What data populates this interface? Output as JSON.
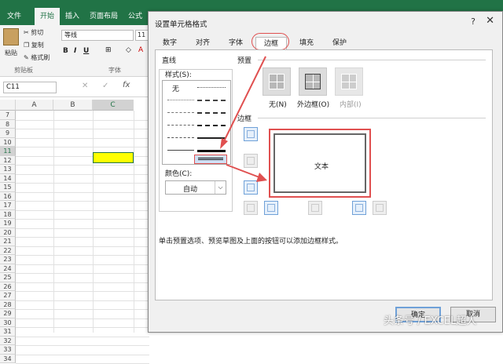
{
  "excel": {
    "tabs": [
      "文件",
      "开始",
      "插入",
      "页面布局",
      "公式"
    ],
    "active_tab": "开始",
    "clipboard": {
      "paste": "粘贴",
      "cut": "剪切",
      "copy": "复制",
      "format_painter": "格式刷",
      "group": "剪贴板"
    },
    "font": {
      "name": "等线",
      "size": "11",
      "group": "字体"
    },
    "name_box": "C11",
    "columns": [
      "A",
      "B",
      "C"
    ],
    "rows": [
      "7",
      "8",
      "9",
      "10",
      "11",
      "12",
      "13",
      "14",
      "15",
      "16",
      "17",
      "18",
      "19",
      "20",
      "21",
      "22",
      "23",
      "24",
      "25",
      "26",
      "27",
      "28",
      "29",
      "30",
      "31",
      "32",
      "33",
      "34"
    ],
    "fill_color": "#ffff00"
  },
  "dialog": {
    "title": "设置单元格格式",
    "help": "?",
    "close": "✕",
    "tabs": [
      "数字",
      "对齐",
      "字体",
      "边框",
      "填充",
      "保护"
    ],
    "active_tab": "边框",
    "line_section": "直线",
    "style_label": "样式(S):",
    "style_none": "无",
    "color_label": "颜色(C):",
    "color_value": "自动",
    "preset_section": "预置",
    "presets": [
      "无(N)",
      "外边框(O)",
      "内部(I)"
    ],
    "border_section": "边框",
    "preview_text": "文本",
    "hint": "单击预置选项、预览草图及上面的按钮可以添加边框样式。",
    "ok": "确定",
    "cancel": "取消",
    "highlight_color": "#e05050"
  },
  "watermark": "头条号 / EXCEL超人"
}
